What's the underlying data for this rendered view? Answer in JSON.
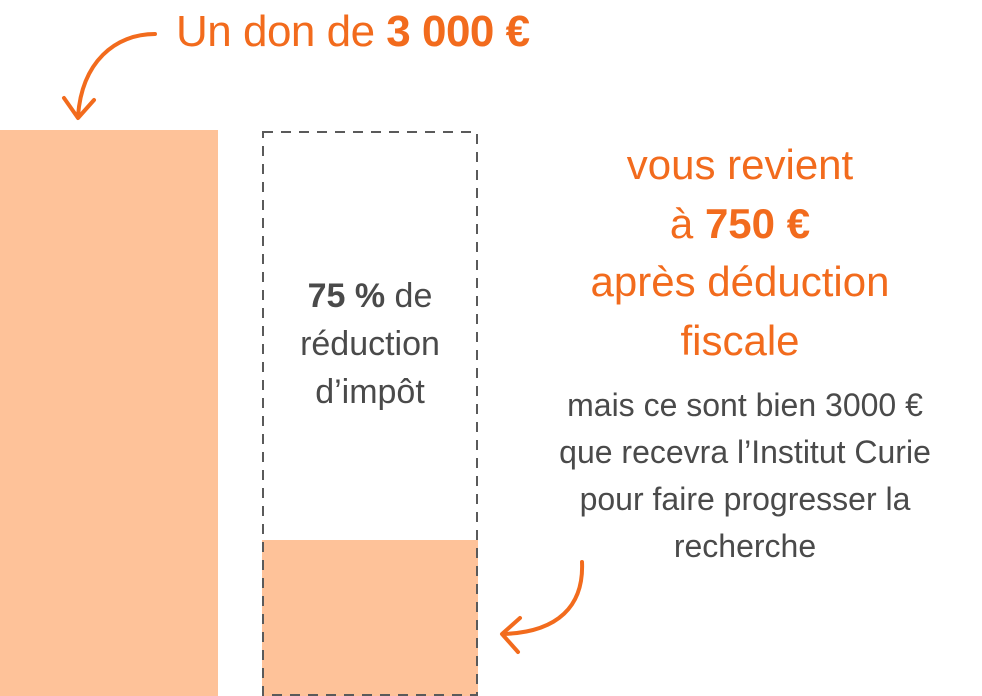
{
  "headline": {
    "prefix": "Un don de ",
    "amount": "3 000 €"
  },
  "reduction": {
    "percent": "75 %",
    "line1_rest": " de",
    "line2": "réduction",
    "line3": "d’impôt"
  },
  "result": {
    "line1": "vous revient",
    "line2_prefix": "à ",
    "line2_amount": "750 €",
    "line3": "après déduction",
    "line4": "fiscale"
  },
  "note": {
    "line1": "mais ce sont bien 3000 €",
    "line2": "que recevra l’Institut Curie",
    "line3": "pour faire progresser la",
    "line4": "recherche"
  },
  "bars": {
    "donation_value": 3000,
    "net_cost_value": 750,
    "net_cost_fraction": 0.25
  },
  "colors": {
    "accent": "#f26b1d",
    "bar_fill": "#fec299",
    "text_dark": "#4a4a4a",
    "dash": "#5a5a5a"
  },
  "icons": {
    "top_arrow": "curved-arrow-down-icon",
    "bottom_arrow": "curved-arrow-left-icon"
  }
}
